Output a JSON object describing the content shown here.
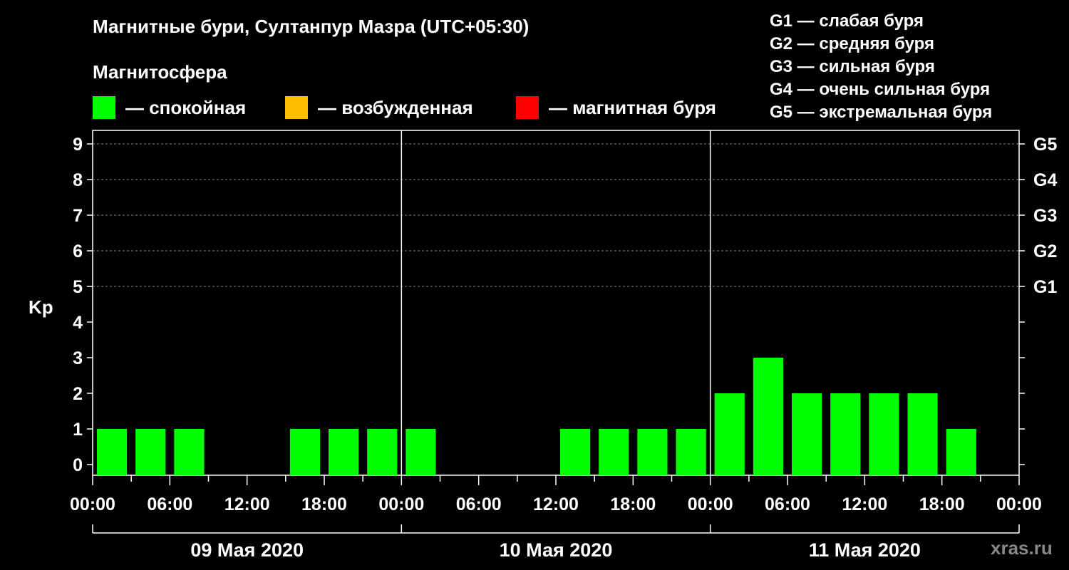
{
  "chart_data": {
    "type": "bar",
    "title": "Магнитные бури, Султанпур Мазра (UTC+05:30)",
    "ylabel": "Kp",
    "ylim": [
      0,
      9
    ],
    "yticks": [
      "0",
      "1",
      "2",
      "3",
      "4",
      "5",
      "6",
      "7",
      "8",
      "9"
    ],
    "right_ticks": [
      {
        "kp": 5,
        "label": "G1"
      },
      {
        "kp": 6,
        "label": "G2"
      },
      {
        "kp": 7,
        "label": "G3"
      },
      {
        "kp": 8,
        "label": "G4"
      },
      {
        "kp": 9,
        "label": "G5"
      }
    ],
    "xticks": [
      "00:00",
      "06:00",
      "12:00",
      "18:00",
      "00:00",
      "06:00",
      "12:00",
      "18:00",
      "00:00",
      "06:00",
      "12:00",
      "18:00",
      "00:00"
    ],
    "days": [
      "09 Мая 2020",
      "10 Мая 2020",
      "11 Мая 2020"
    ],
    "hours_per_bar": 3,
    "values": [
      1,
      1,
      1,
      0,
      0,
      1,
      1,
      1,
      1,
      0,
      0,
      0,
      1,
      1,
      1,
      1,
      2,
      3,
      2,
      2,
      2,
      2,
      1,
      0
    ],
    "grid": "dashed at Kp 5-9",
    "legend_placement": "top"
  },
  "magnetosphere": {
    "title": "Магнитосфера",
    "legend": [
      {
        "label": "— спокойная",
        "color": "#00ff00"
      },
      {
        "label": "— возбужденная",
        "color": "#ffbf00"
      },
      {
        "label": "— магнитная буря",
        "color": "#ff0000"
      }
    ]
  },
  "g_scale": [
    "G1 — слабая буря",
    "G2 — средняя буря",
    "G3 — сильная буря",
    "G4 — очень сильная буря",
    "G5 — экстремальная буря"
  ],
  "watermark": "xras.ru"
}
